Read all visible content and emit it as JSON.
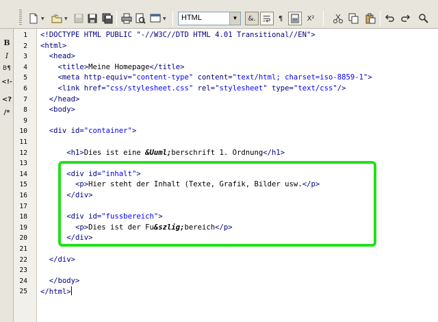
{
  "toolbar": {
    "doctype_select": "HTML",
    "entity_button": "&.",
    "pilcrow_button": "¶",
    "superscript_button": "X²"
  },
  "leftbar": {
    "bold": "B",
    "italic": "I",
    "block": "B¶",
    "comment": "<!-",
    "php": "<?",
    "comment2": "/*"
  },
  "editor": {
    "line_numbers": [
      "1",
      "2",
      "3",
      "4",
      "5",
      "6",
      "7",
      "8",
      "9",
      "10",
      "11",
      "12",
      "13",
      "14",
      "15",
      "16",
      "17",
      "18",
      "19",
      "20",
      "21",
      "22",
      "23",
      "24",
      "25"
    ],
    "lines": {
      "l1": "<!DOCTYPE HTML PUBLIC \"-//W3C//DTD HTML 4.01 Transitional//EN\">",
      "l2": "<html>",
      "l3": "  <head>",
      "l4a": "    <title>",
      "l4b": "Meine Homepage",
      "l4c": "</title>",
      "l5a": "    <meta http-equiv=",
      "l5b": "\"content-type\"",
      "l5c": " content=",
      "l5d": "\"text/html; charset=iso-8859-1\"",
      "l5e": ">",
      "l6a": "    <link href=",
      "l6b": "\"css/stylesheet.css\"",
      "l6c": " rel=",
      "l6d": "\"stylesheet\"",
      "l6e": " type=",
      "l6f": "\"text/css\"",
      "l6g": "/>",
      "l7": "  </head>",
      "l8": "  <body>",
      "l10a": "  <div id=",
      "l10b": "\"container\"",
      "l10c": ">",
      "l12a": "      <h1>",
      "l12b": "Dies ist eine ",
      "l12c": "&Uuml;",
      "l12d": "berschrift 1. Ordnung",
      "l12e": "</h1>",
      "l14a": "      <div id=",
      "l14b": "\"inhalt\"",
      "l14c": ">",
      "l15a": "        <p>",
      "l15b": "Hier steht der Inhalt (Texte, Grafik, Bilder usw.",
      "l15c": "</p>",
      "l16": "      </div>",
      "l18a": "      <div id=",
      "l18b": "\"fussbereich\"",
      "l18c": ">",
      "l19a": "        <p>",
      "l19b": "Dies ist der Fu",
      "l19c": "&szlig;",
      "l19d": "bereich",
      "l19e": "</p>",
      "l20": "      </div>",
      "l22": "  </div>",
      "l24": "  </body>",
      "l25": "</html>"
    }
  },
  "colors": {
    "highlight_border": "#22e01a",
    "tag_color": "#000080",
    "value_color": "#0000ff"
  }
}
